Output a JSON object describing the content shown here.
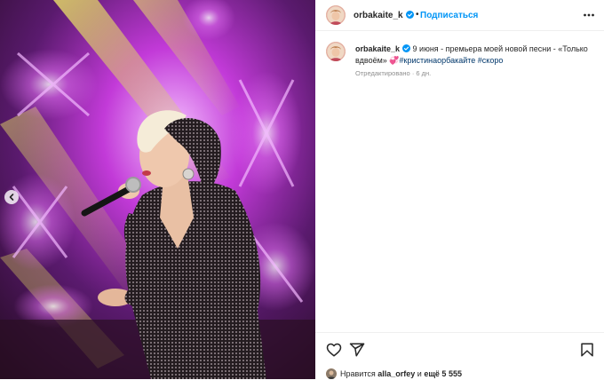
{
  "post": {
    "author": "orbakaite_k",
    "follow_label": "Подписаться",
    "separator": "•",
    "caption_text": " 9 июня - премьера моей новой песни - «Только вдвоём» 💞",
    "hashtags": "#кристинаорбакайте #скоро",
    "edited_label": "Отредактировано",
    "age": "6 дн.",
    "likes_prefix": "Нравится",
    "likes_user": "alla_orfey",
    "likes_and": "и",
    "likes_more": "ещё 5 555"
  },
  "colors": {
    "link_blue": "#0095f6",
    "hashtag": "#00376b",
    "muted": "#8e8e8e",
    "verified": "#0095f6",
    "stage_purple": "#a020c8",
    "stage_yellow": "#f2e04a"
  },
  "icons": {
    "verified": "verified-badge-icon",
    "more": "more-options-icon",
    "like": "heart-icon",
    "share": "paper-plane-icon",
    "save": "bookmark-icon",
    "carousel_prev": "chevron-left-icon"
  }
}
